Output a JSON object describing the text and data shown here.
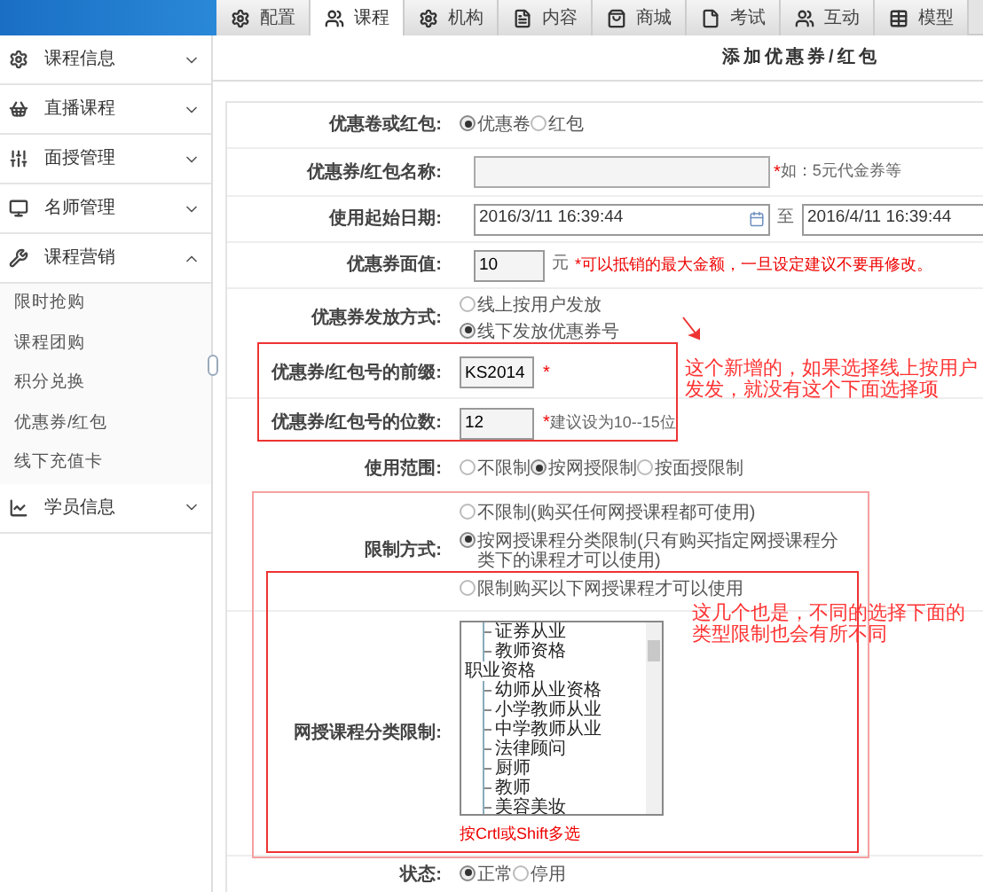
{
  "top_tabs": [
    {
      "label": "配置",
      "selected": false
    },
    {
      "label": "课程",
      "selected": true
    },
    {
      "label": "机构",
      "selected": false
    },
    {
      "label": "内容",
      "selected": false
    },
    {
      "label": "商城",
      "selected": false
    },
    {
      "label": "考试",
      "selected": false
    },
    {
      "label": "互动",
      "selected": false
    },
    {
      "label": "模型",
      "selected": false
    }
  ],
  "sidebar": [
    {
      "label": "课程信息",
      "expanded": false
    },
    {
      "label": "直播课程",
      "expanded": false
    },
    {
      "label": "面授管理",
      "expanded": false
    },
    {
      "label": "名师管理",
      "expanded": false
    },
    {
      "label": "课程营销",
      "expanded": true,
      "children": [
        {
          "label": "限时抢购"
        },
        {
          "label": "课程团购"
        },
        {
          "label": "积分兑换"
        },
        {
          "label": "优惠券/红包"
        },
        {
          "label": "线下充值卡"
        }
      ]
    },
    {
      "label": "学员信息",
      "expanded": false
    }
  ],
  "page_title": "添加优惠券/红包",
  "form": {
    "coupon_type": {
      "label": "优惠卷或红包:",
      "options": [
        {
          "label": "优惠卷",
          "selected": true
        },
        {
          "label": "红包",
          "selected": false
        }
      ]
    },
    "name": {
      "label": "优惠券/红包名称:",
      "required_mark": "*",
      "hint": "如：5元代金券等"
    },
    "dates": {
      "label": "使用起始日期:",
      "start": "2016/3/11 16:39:44",
      "separator": "至",
      "end": "2016/4/11 16:39:44"
    },
    "face_value": {
      "label": "优惠券面值:",
      "value": "10",
      "unit": "元",
      "note": "*可以抵销的最大金额，一旦设定建议不要再修改。"
    },
    "issue_method": {
      "label": "优惠券发放方式:",
      "options": [
        {
          "label": "线上按用户发放",
          "selected": false
        },
        {
          "label": "线下发放优惠券号",
          "selected": true
        }
      ]
    },
    "prefix": {
      "label": "优惠券/红包号的前缀:",
      "value": "KS2014",
      "required_mark": "*"
    },
    "digits": {
      "label": "优惠券/红包号的位数:",
      "value": "12",
      "required_mark": "*",
      "hint": "建议设为10--15位"
    },
    "scope": {
      "label": "使用范围:",
      "options": [
        {
          "label": "不限制",
          "selected": false
        },
        {
          "label": "按网授限制",
          "selected": true
        },
        {
          "label": "按面授限制",
          "selected": false
        }
      ]
    },
    "limit_mode": {
      "label": "限制方式:",
      "options": [
        {
          "label": "不限制(购买任何网授课程都可使用)",
          "selected": false
        },
        {
          "label": "按网授课程分类限制(只有购买指定网授课程分类下的课程才可以使用)",
          "selected": true
        },
        {
          "label": "限制购买以下网授课程才可以使用",
          "selected": false
        }
      ]
    },
    "category": {
      "label": "网授课程分类限制:",
      "options": [
        {
          "children": [
            {
              "label": "证券从业"
            },
            {
              "label": "教师资格"
            }
          ]
        },
        {
          "label": "职业资格",
          "children": [
            {
              "label": "幼师从业资格"
            },
            {
              "label": "小学教师从业"
            },
            {
              "label": "中学教师从业"
            },
            {
              "label": "法律顾问"
            },
            {
              "label": "厨师"
            },
            {
              "label": "教师"
            },
            {
              "label": "美容美妆"
            }
          ]
        }
      ],
      "hint": "按Crtl或Shift多选"
    },
    "status": {
      "label": "状态:",
      "options": [
        {
          "label": "正常",
          "selected": true
        },
        {
          "label": "停用",
          "selected": false
        }
      ]
    }
  },
  "annotations": [
    {
      "text": "这个新增的，如果选择线上按用户发发，就没有这个下面选择项"
    },
    {
      "text": "这几个也是，不同的选择下面的类型限制也会有所不同"
    }
  ]
}
